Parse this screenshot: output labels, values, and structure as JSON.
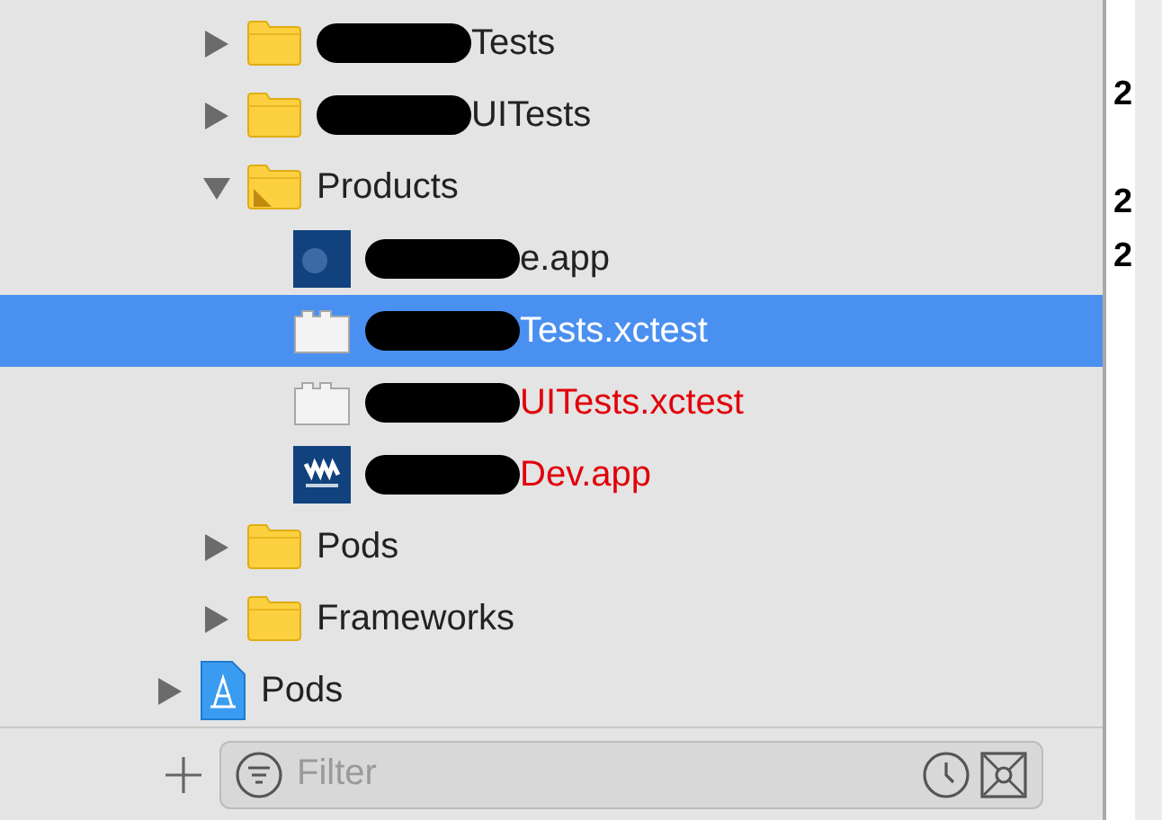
{
  "navigator": {
    "items": [
      {
        "kind": "folder",
        "label": "Tests",
        "redacted": true,
        "expanded": false,
        "selected": false,
        "missing": false
      },
      {
        "kind": "folder",
        "label": "UITests",
        "redacted": true,
        "expanded": false,
        "selected": false,
        "missing": false
      },
      {
        "kind": "products-folder",
        "label": "Products",
        "redacted": false,
        "expanded": true,
        "selected": false,
        "missing": false,
        "children": [
          {
            "kind": "app",
            "label": "e.app",
            "redacted": true,
            "selected": false,
            "missing": false
          },
          {
            "kind": "xctest",
            "label": "Tests.xctest",
            "redacted": true,
            "selected": true,
            "missing": false
          },
          {
            "kind": "xctest",
            "label": "UITests.xctest",
            "redacted": true,
            "selected": false,
            "missing": true
          },
          {
            "kind": "resume-app",
            "label": "Dev.app",
            "redacted": true,
            "selected": false,
            "missing": true
          }
        ]
      },
      {
        "kind": "folder",
        "label": "Pods",
        "redacted": false,
        "expanded": false,
        "selected": false,
        "missing": false
      },
      {
        "kind": "folder",
        "label": "Frameworks",
        "redacted": false,
        "expanded": false,
        "selected": false,
        "missing": false
      }
    ],
    "projects": [
      {
        "kind": "project",
        "label": "Pods",
        "redacted": false,
        "expanded": false,
        "selected": false,
        "missing": false
      }
    ]
  },
  "filter": {
    "placeholder": "Filter"
  },
  "editor_gutter": [
    {
      "kind": "text",
      "text": "2"
    },
    {
      "kind": "blank"
    },
    {
      "kind": "text",
      "text": "2"
    },
    {
      "kind": "text",
      "text": "2"
    }
  ]
}
